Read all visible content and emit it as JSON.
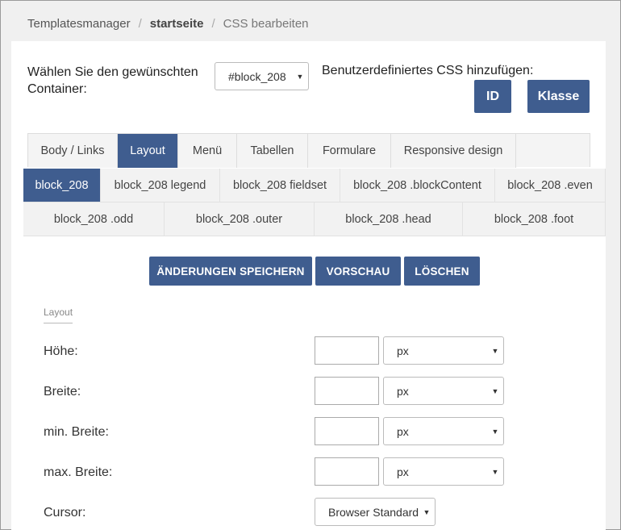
{
  "breadcrumb": {
    "root": "Templatesmanager",
    "middle": "startseite",
    "current": "CSS bearbeiten"
  },
  "container": {
    "label": "Wählen Sie den gewünschten Container:",
    "selected": "#block_208"
  },
  "custom_css": {
    "label": "Benutzerdefiniertes CSS hinzufügen:",
    "id_button": "ID",
    "class_button": "Klasse"
  },
  "tabs": [
    {
      "label": "Body / Links",
      "active": false
    },
    {
      "label": "Layout",
      "active": true
    },
    {
      "label": "Menü",
      "active": false
    },
    {
      "label": "Tabellen",
      "active": false
    },
    {
      "label": "Formulare",
      "active": false
    },
    {
      "label": "Responsive design",
      "active": false
    }
  ],
  "subtabs_row1": [
    {
      "label": "block_208",
      "active": true
    },
    {
      "label": "block_208 legend",
      "active": false
    },
    {
      "label": "block_208 fieldset",
      "active": false
    },
    {
      "label": "block_208 .blockContent",
      "active": false
    },
    {
      "label": "block_208 .even",
      "active": false
    }
  ],
  "subtabs_row2": [
    {
      "label": "block_208 .odd"
    },
    {
      "label": "block_208 .outer"
    },
    {
      "label": "block_208 .head"
    },
    {
      "label": "block_208 .foot"
    }
  ],
  "actions": {
    "save": "ÄNDERUNGEN SPEICHERN",
    "preview": "VORSCHAU",
    "delete": "LÖSCHEN"
  },
  "section": {
    "title": "Layout"
  },
  "fields": {
    "hoehe": {
      "label": "Höhe:",
      "value": "",
      "unit": "px"
    },
    "breite": {
      "label": "Breite:",
      "value": "",
      "unit": "px"
    },
    "min_breite": {
      "label": "min. Breite:",
      "value": "",
      "unit": "px"
    },
    "max_breite": {
      "label": "max. Breite:",
      "value": "",
      "unit": "px"
    },
    "cursor": {
      "label": "Cursor:",
      "value": "Browser Standard"
    }
  },
  "icons": {
    "caret": "caret-down-icon"
  },
  "colors": {
    "accent": "#3f5d8f"
  }
}
